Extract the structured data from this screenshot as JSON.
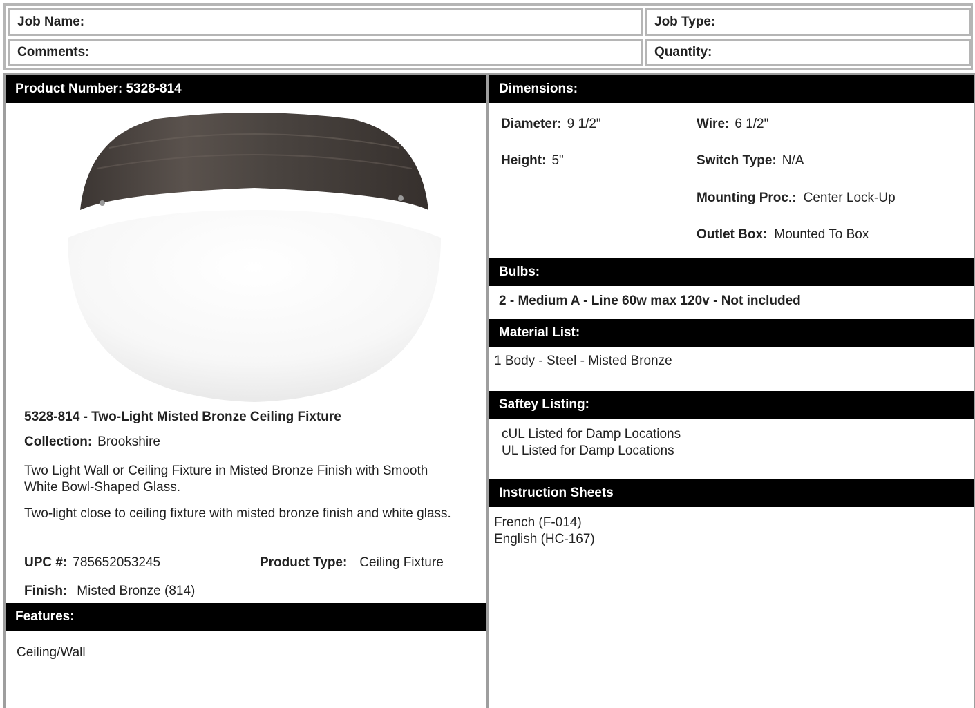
{
  "job": {
    "name_label": "Job Name:",
    "type_label": "Job Type:",
    "comments_label": "Comments:",
    "quantity_label": "Quantity:"
  },
  "product": {
    "header": "Product Number: 5328-814",
    "title": "5328-814 - Two-Light Misted Bronze Ceiling Fixture",
    "collection_label": "Collection:",
    "collection_value": "Brookshire",
    "description1": "Two Light Wall or Ceiling Fixture in Misted Bronze Finish with Smooth White Bowl-Shaped Glass.",
    "description2": "Two-light close to ceiling fixture with misted bronze finish and white glass.",
    "upc_label": "UPC #:",
    "upc_value": "785652053245",
    "type_label": "Product Type:",
    "type_value": "Ceiling Fixture",
    "finish_label": "Finish:",
    "finish_value": "Misted Bronze (814)",
    "image_icon": "ceiling-fixture-photo"
  },
  "features": {
    "header": "Features:",
    "text": "Ceiling/Wall"
  },
  "dimensions": {
    "header": "Dimensions:",
    "diameter_label": "Diameter:",
    "diameter_value": "9 1/2\"",
    "height_label": "Height:",
    "height_value": "5\"",
    "wire_label": "Wire:",
    "wire_value": "6 1/2\"",
    "switch_label": "Switch Type:",
    "switch_value": "N/A",
    "mounting_label": "Mounting Proc.:",
    "mounting_value": "Center Lock-Up",
    "outlet_label": "Outlet Box:",
    "outlet_value": "Mounted To Box"
  },
  "bulbs": {
    "header": "Bulbs:",
    "text": "2 - Medium A - Line 60w max 120v - Not included"
  },
  "materials": {
    "header": "Material List:",
    "text": "1 Body - Steel - Misted Bronze"
  },
  "safety": {
    "header": "Saftey Listing:",
    "line1": "cUL Listed for Damp Locations",
    "line2": "UL Listed for Damp Locations"
  },
  "instructions": {
    "header": "Instruction Sheets",
    "line1": "French (F-014)",
    "line2": "English (HC-167)"
  },
  "colors": {
    "header_bg": "#000000",
    "border": "#b5b5b5",
    "bronze": "#4a4440"
  }
}
